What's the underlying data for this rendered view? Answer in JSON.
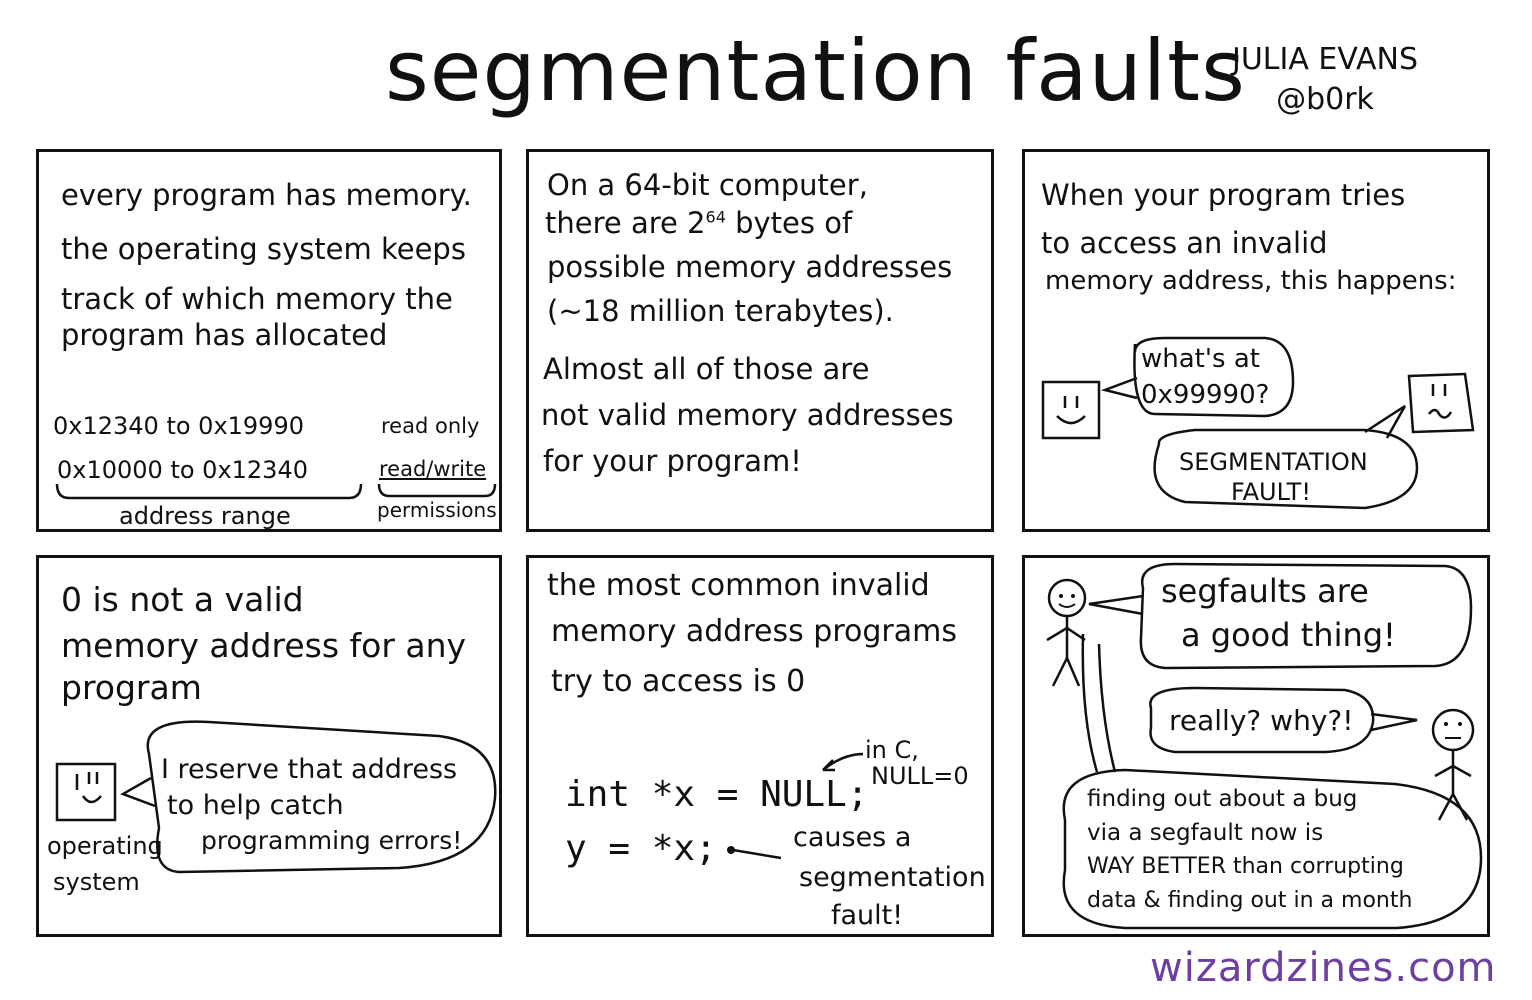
{
  "title": "segmentation faults",
  "author": {
    "name": "JULIA EVANS",
    "handle": "@b0rk"
  },
  "panel1": {
    "line1": "every program has memory.",
    "line2": "the operating system keeps",
    "line3": "track of which memory the",
    "line4": "program has allocated",
    "row1_range": "0x12340  to  0x19990",
    "row1_perm": "read only",
    "row2_range": "0x10000 to  0x12340",
    "row2_perm": "read/write",
    "label_range": "address range",
    "label_perm": "permissions"
  },
  "panel2": {
    "line1": "On  a  64-bit  computer,",
    "line2a": "there  are  2",
    "line2sup": "64",
    "line2b": " bytes  of",
    "line3": "possible  memory  addresses",
    "line4": "(~18 million terabytes).",
    "line5": "Almost all of those are",
    "line6": "not valid  memory addresses",
    "line7": "for  your  program!"
  },
  "panel3": {
    "line1": "When  your  program tries",
    "line2": "to access  an  invalid",
    "line3": "memory address, this happens:",
    "bubble1_l1": "what's  at",
    "bubble1_l2": "0x99990?",
    "bubble2_l1": "SEGMENTATION",
    "bubble2_l2": "FAULT!"
  },
  "panel4": {
    "line1": "0  is  not a valid",
    "line2": "memory address  for  any",
    "line3": "program",
    "bubble_l1": "I reserve  that address",
    "bubble_l2": "to  help catch",
    "bubble_l3": "programming errors!",
    "os_l1": "operating",
    "os_l2": "system"
  },
  "panel5": {
    "line1": "the  most  common  invalid",
    "line2": "memory  address  programs",
    "line3": "try  to  access  is  0",
    "code1": "int *x = NULL;",
    "code2": "y = *x;",
    "note1_l1": "in C,",
    "note1_l2": "NULL=0",
    "note2_l1": "causes a",
    "note2_l2": "segmentation",
    "note2_l3": "fault!"
  },
  "panel6": {
    "bubble1_l1": "segfaults  are",
    "bubble1_l2": "a  good  thing!",
    "bubble2": "really? why?!",
    "bubble3_l1": "finding out about a bug",
    "bubble3_l2": "via a segfault now is",
    "bubble3_l3": "WAY BETTER than corrupting",
    "bubble3_l4": "data & finding out in a month"
  },
  "footer": "wizardzines.com"
}
